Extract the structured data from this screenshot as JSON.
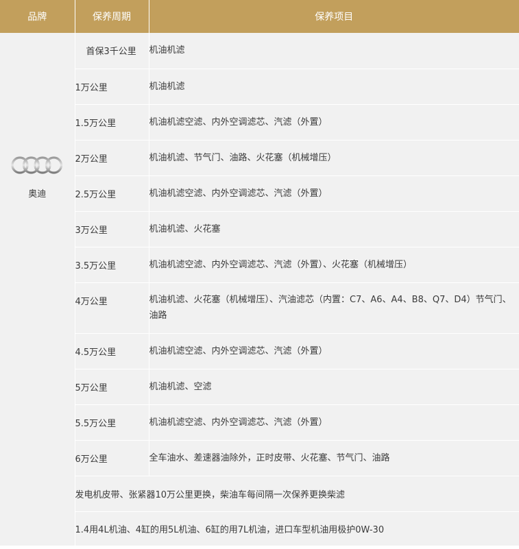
{
  "header": {
    "brand": "品牌",
    "period": "保养周期",
    "items": "保养项目"
  },
  "brand": {
    "name": "奥迪",
    "logo_icon": "audi-rings-icon"
  },
  "rows": [
    {
      "period": "首保3千公里",
      "items": "机油机滤"
    },
    {
      "period": "1万公里",
      "items": "机油机滤"
    },
    {
      "period": "1.5万公里",
      "items": "机油机滤空滤、内外空调滤芯、汽滤（外置）"
    },
    {
      "period": "2万公里",
      "items": "机油机滤、节气门、油路、火花塞（机械增压）"
    },
    {
      "period": "2.5万公里",
      "items": "机油机滤空滤、内外空调滤芯、汽滤（外置）"
    },
    {
      "period": "3万公里",
      "items": "机油机滤、火花塞"
    },
    {
      "period": "3.5万公里",
      "items": "机油机滤空滤、内外空调滤芯、汽滤（外置）、火花塞（机械增压）"
    },
    {
      "period": "4万公里",
      "items": "机油机滤、火花塞（机械增压）、汽油滤芯（内置：C7、A6、A4、B8、Q7、D4）节气门、油路"
    },
    {
      "period": "4.5万公里",
      "items": "机油机滤空滤、内外空调滤芯、汽滤（外置）"
    },
    {
      "period": "5万公里",
      "items": "机油机滤、空滤"
    },
    {
      "period": "5.5万公里",
      "items": "机油机滤空滤、内外空调滤芯、汽滤（外置）"
    },
    {
      "period": "6万公里",
      "items": "全车油水、差速器油除外，正时皮带、火花塞、节气门、油路"
    }
  ],
  "notes": [
    "发电机皮带、张紧器10万公里更换，柴油车每间隔一次保养更换柴滤",
    "1.4用4L机油、4缸的用5L机油、6缸的用7L机油，进口车型机油用极护0W-30"
  ],
  "colors": {
    "header_bg": "#c29f5c",
    "body_bg": "#f1f1f1",
    "text": "#3a3a3a"
  }
}
